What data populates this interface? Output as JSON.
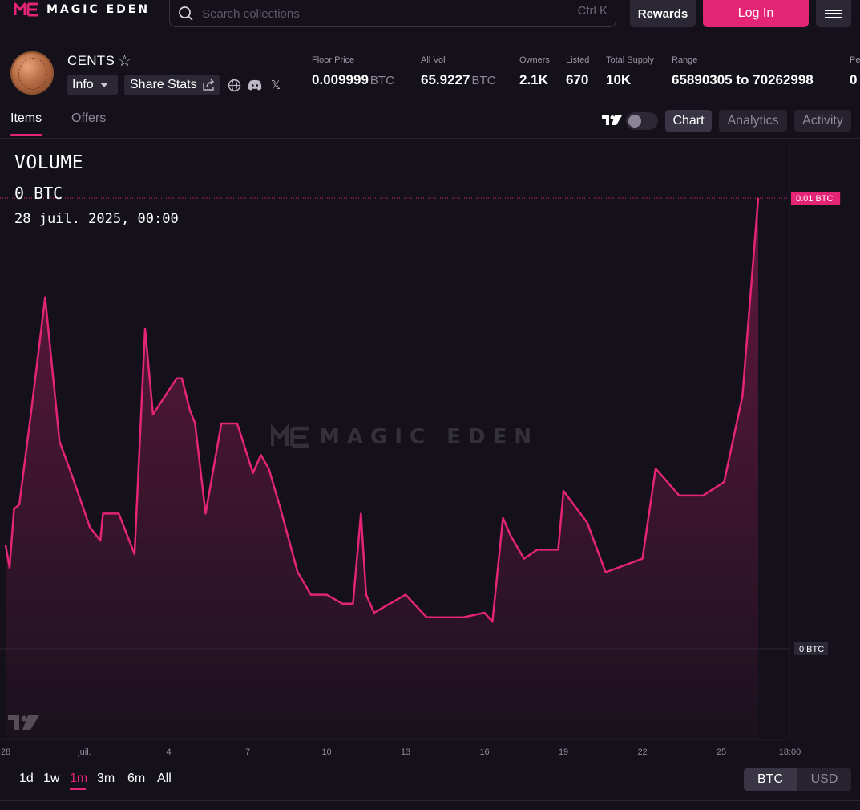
{
  "app": {
    "logo_text": "MAGIC EDEN",
    "brand_color": "#e42575"
  },
  "search": {
    "placeholder": "Search collections",
    "shortcut": "Ctrl  K"
  },
  "nav": {
    "rewards_label": "Rewards",
    "login_label": "Log In"
  },
  "collection": {
    "name": "CENTS",
    "info_label": "Info",
    "share_label": "Share Stats",
    "stats": [
      {
        "label": "Floor Price",
        "value": "0.009999",
        "unit": "BTC"
      },
      {
        "label": "All Vol",
        "value": "65.9227",
        "unit": "BTC"
      },
      {
        "label": "Owners",
        "value": "2.1K",
        "unit": ""
      },
      {
        "label": "Listed",
        "value": "670",
        "unit": ""
      },
      {
        "label": "Total Supply",
        "value": "10K",
        "unit": ""
      },
      {
        "label": "Range",
        "value": "65890305 to 70262998",
        "unit": ""
      },
      {
        "label": "Pe",
        "value": "0",
        "unit": ""
      }
    ]
  },
  "tabs": {
    "items": "Items",
    "offers": "Offers"
  },
  "views": {
    "chart": "Chart",
    "analytics": "Analytics",
    "activity": "Activity"
  },
  "legend": {
    "title": "VOLUME",
    "value": "0 BTC",
    "date": "28 juil. 2025, 00:00"
  },
  "chart_data": {
    "type": "area",
    "ylabel": "",
    "y_tick_labels": [
      "0.01 BTC",
      "0 BTC"
    ],
    "x_tick_labels": [
      "28",
      "juil.",
      "4",
      "7",
      "10",
      "13",
      "16",
      "19",
      "22",
      "25",
      "18:00"
    ],
    "x": [
      0,
      0.15,
      0.32,
      0.52,
      0.98,
      1.5,
      2.05,
      2.55,
      3.2,
      3.6,
      3.7,
      4.3,
      4.9,
      5.3,
      5.6,
      6.5,
      6.7,
      7.0,
      7.2,
      7.6,
      8.2,
      8.8,
      9.4,
      9.7,
      10.0,
      10.4,
      11.1,
      11.6,
      12.2,
      12.8,
      13.2,
      13.5,
      13.7,
      14.0,
      15.2,
      16.0,
      17.4,
      18.2,
      18.5,
      18.9,
      19.2,
      19.7,
      20.2,
      21.0,
      21.2,
      22.1,
      22.8,
      24.2,
      24.7,
      25.6,
      26.5,
      27.3,
      28.0,
      28.6
    ],
    "values": [
      0.0023,
      0.0018,
      0.0031,
      0.0032,
      0.0053,
      0.0078,
      0.0046,
      0.0038,
      0.0027,
      0.0024,
      0.003,
      0.003,
      0.0021,
      0.0071,
      0.0052,
      0.006,
      0.006,
      0.0053,
      0.005,
      0.003,
      0.005,
      0.005,
      0.0039,
      0.0043,
      0.004,
      0.0032,
      0.0017,
      0.0012,
      0.0012,
      0.001,
      0.001,
      0.003,
      0.0012,
      0.0008,
      0.0012,
      0.0007,
      0.0007,
      0.0008,
      0.0006,
      0.0029,
      0.0025,
      0.002,
      0.0022,
      0.0022,
      0.0035,
      0.0028,
      0.0017,
      0.002,
      0.004,
      0.0034,
      0.0034,
      0.0037,
      0.0056,
      0.01
    ],
    "ylim": [
      0,
      0.01
    ],
    "line_color": "#e42575",
    "grid": false
  },
  "range": {
    "options": [
      "1d",
      "1w",
      "1m",
      "3m",
      "6m",
      "All"
    ],
    "active": "1m"
  },
  "currency": {
    "btc": "BTC",
    "usd": "USD",
    "active": "BTC"
  }
}
